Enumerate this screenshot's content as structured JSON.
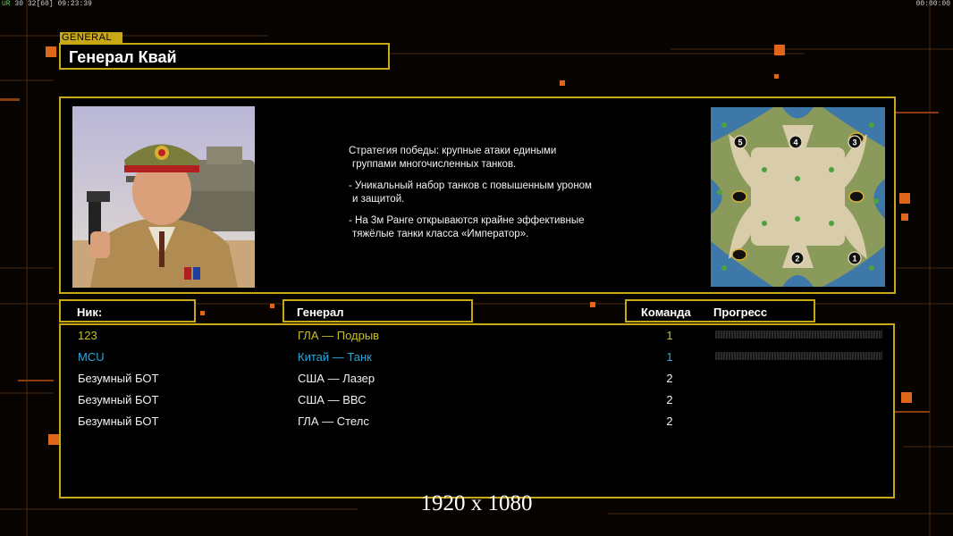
{
  "status_bar": {
    "stat_ur": "UR",
    "stat_values": "30 32",
    "stat_fps": "[60]",
    "time": "09:23:39",
    "timer_right": "00:00:00"
  },
  "general_badge": "GENERAL",
  "general_name": "Генерал Квай",
  "description": {
    "line1a": "Стратегия победы: крупные атаки едиными",
    "line1b": "группами многочисленных танков.",
    "line2a": "- Уникальный набор танков с повышенным уроном",
    "line2b": "и защитой.",
    "line3a": "- На 3м Ранге открываются крайне эффективные",
    "line3b": "тяжёлые танки класса «Император»."
  },
  "minimap": {
    "start_positions": [
      "1",
      "2",
      "3",
      "4",
      "5"
    ]
  },
  "columns": {
    "nick": "Ник:",
    "general": "Генерал",
    "team": "Команда",
    "progress": "Прогресс"
  },
  "players": [
    {
      "nick": "123",
      "general": "ГЛА — Подрыв",
      "team": "1",
      "color": "#c8c020",
      "progress": 0
    },
    {
      "nick": "MCU",
      "general": "Китай — Танк",
      "team": "1",
      "color": "#28a8dc",
      "progress": 0
    },
    {
      "nick": "Безумный БОТ",
      "general": "США — Лазер",
      "team": "2",
      "color": "#f0f0f0"
    },
    {
      "nick": "Безумный БОТ",
      "general": "США — ВВС",
      "team": "2",
      "color": "#f0f0f0"
    },
    {
      "nick": "Безумный БОТ",
      "general": "ГЛА — Стелс",
      "team": "2",
      "color": "#f0f0f0"
    }
  ],
  "resolution_caption": "1920 x 1080",
  "colors": {
    "frame": "#c9a818",
    "accent": "#e0661a"
  }
}
